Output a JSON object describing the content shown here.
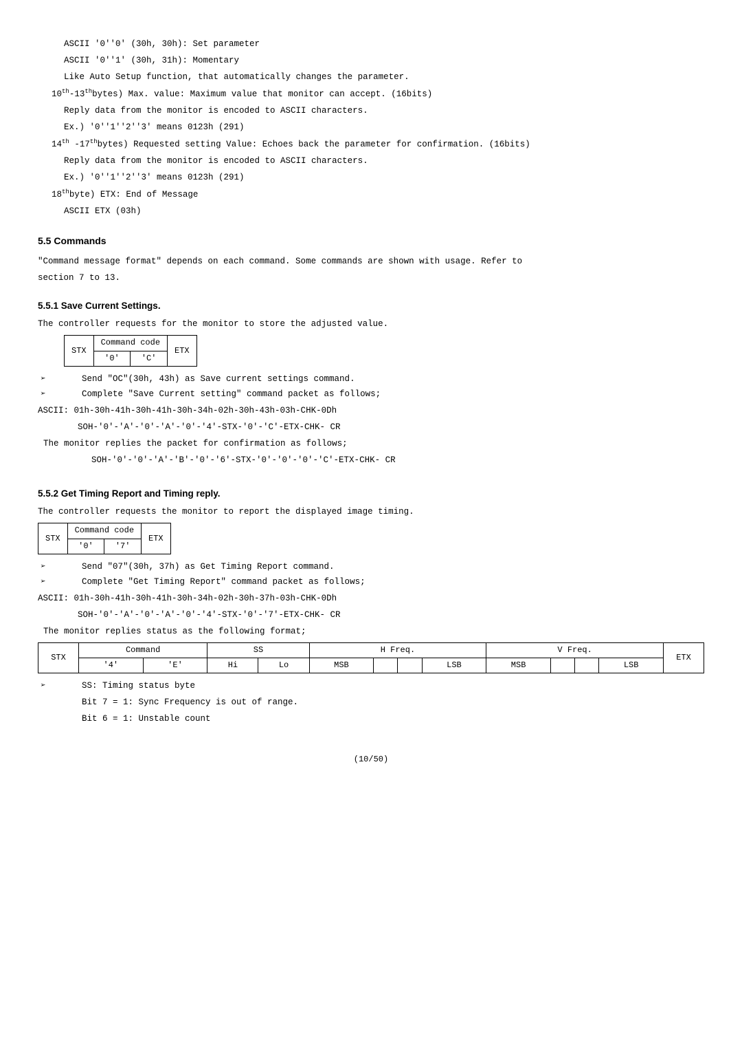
{
  "top_block": {
    "line1": "ASCII '0''0' (30h, 30h): Set parameter",
    "line2": "ASCII '0''1' (30h, 31h): Momentary",
    "line3": "Like Auto Setup function, that automatically changes the parameter.",
    "line4_pre": "10",
    "line4_sup": "th",
    "line4_mid": "-13",
    "line4_sup2": "th",
    "line4_rest": "bytes) Max. value: Maximum value that monitor can accept. (16bits)",
    "line5": "Reply data from the monitor is encoded to ASCII characters.",
    "line6": "Ex.) '0''1''2''3' means 0123h (291)",
    "line7_pre": "14",
    "line7_sup": "th",
    "line7_mid": " -17",
    "line7_sup2": "th",
    "line7_rest": "bytes) Requested setting Value: Echoes back the parameter for confirmation. (16bits)",
    "line8": "Reply data from the monitor is encoded to ASCII characters.",
    "line9": "Ex.) '0''1''2''3' means 0123h (291)",
    "line10_pre": "18",
    "line10_sup": "th",
    "line10_rest": "byte) ETX: End of Message",
    "line11": "ASCII ETX (03h)"
  },
  "sec55": {
    "heading": "5.5 Commands",
    "p1": "\"Command message format\" depends on each command.  Some commands are shown with usage. Refer to",
    "p2": "section 7 to 13."
  },
  "sec551": {
    "heading": "5.5.1 Save Current Settings.",
    "intro": "The controller requests for the monitor to store the adjusted value.",
    "table": {
      "c1": "STX",
      "c2_top": "Command code",
      "c2_b1": "'0'",
      "c2_b2": "'C'",
      "c3": "ETX"
    },
    "bullet1": "Send \"OC\"(30h, 43h) as Save current settings command.",
    "bullet2": "Complete \"Save Current setting\" command packet as follows;",
    "ascii": "ASCII: 01h-30h-41h-30h-41h-30h-34h-02h-30h-43h-03h-CHK-0Dh",
    "soh1": "SOH-'0'-'A'-'0'-'A'-'0'-'4'-STX-'0'-'C'-ETX-CHK- CR",
    "replies": "The monitor replies the packet for confirmation as follows;",
    "soh2": "SOH-'0'-'0'-'A'-'B'-'0'-'6'-STX-'0'-'0'-'0'-'C'-ETX-CHK- CR"
  },
  "sec552": {
    "heading": "5.5.2 Get Timing Report and Timing reply.",
    "intro": "The controller requests the monitor to report the displayed image timing.",
    "table": {
      "c1": "STX",
      "c2_top": "Command code",
      "c2_b1": "'0'",
      "c2_b2": "'7'",
      "c3": "ETX"
    },
    "bullet1": "Send \"07\"(30h, 37h) as Get Timing Report command.",
    "bullet2": "Complete \"Get Timing Report\" command packet as follows;",
    "ascii": "ASCII: 01h-30h-41h-30h-41h-30h-34h-02h-30h-37h-03h-CHK-0Dh",
    "soh1": "SOH-'0'-'A'-'0'-'A'-'0'-'4'-STX-'0'-'7'-ETX-CHK- CR",
    "replies": "The monitor replies status as the following format;",
    "wide": {
      "stx": "STX",
      "cmd": "Command",
      "ss": "SS",
      "hfreq": "H Freq.",
      "vfreq": "V Freq.",
      "etx": "ETX",
      "r2": {
        "c1": "'4'",
        "c2": "'E'",
        "c3": "Hi",
        "c4": "Lo",
        "c5": "MSB",
        "c6": "",
        "c7": "",
        "c8": "LSB",
        "c9": "MSB",
        "c10": "",
        "c11": "",
        "c12": "LSB"
      }
    },
    "ss_bullet": "SS: Timing status byte",
    "bit7": "Bit 7 = 1: Sync Frequency is out of range.",
    "bit6": "Bit 6 = 1: Unstable count"
  },
  "page": "(10/50)"
}
